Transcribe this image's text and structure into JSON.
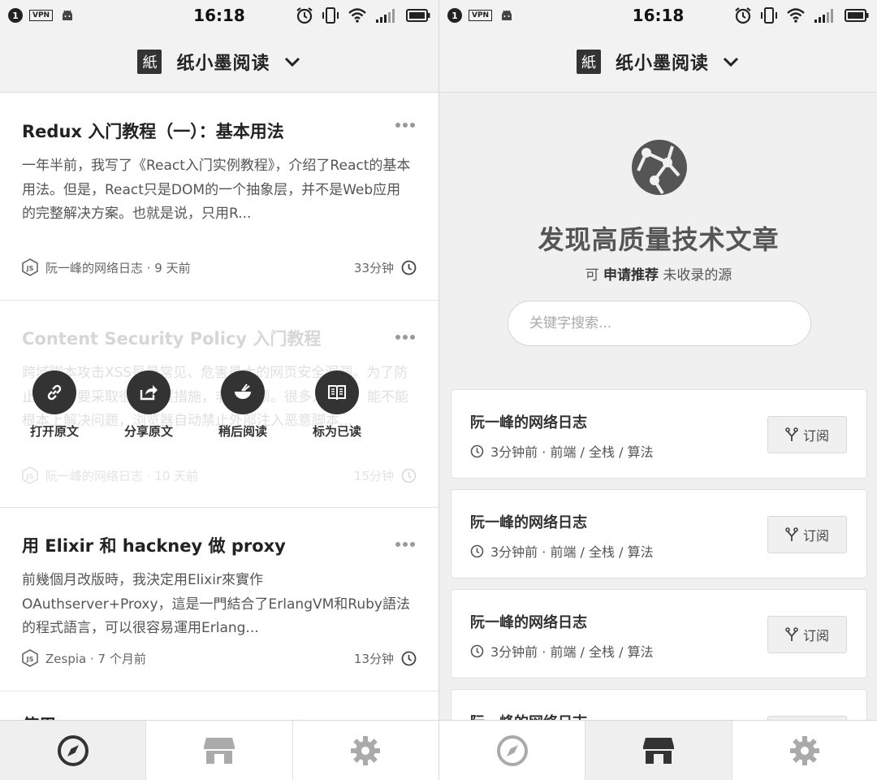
{
  "status_bar": {
    "badge": "1",
    "vpn": "VPN",
    "time": "16:18"
  },
  "header": {
    "logo_char": "紙",
    "title": "纸小墨阅读"
  },
  "feed": {
    "articles": [
      {
        "title": "Redux 入门教程（一）：基本用法",
        "excerpt": "一年半前，我写了《React入门实例教程》，介绍了React的基本用法。但是，React只是DOM的一个抽象层，并不是Web应用的完整解决方案。也就是说，只用R...",
        "source": "阮一峰的网络日志 · 9 天前",
        "read_time": "33分钟"
      },
      {
        "title": "Content Security Policy 入门教程",
        "excerpt": "跨域脚本攻击XSS是最常见、危害最大的网页安全漏洞。为了防止它们，要采取很多编程措施，非常麻烦。很多人提出，能不能根本上解决问题，浏览器自动禁止外部注入恶意脚本...",
        "source": "阮一峰的网络日志 · 10 天前",
        "read_time": "15分钟"
      },
      {
        "title": "用 Elixir 和 hackney 做 proxy",
        "excerpt": "前幾個月改版時，我決定用Elixir來實作OAuthserver+Proxy，這是一門結合了ErlangVM和Ruby語法的程式語言，可以很容易運用Erlang...",
        "source": "Zespia · 7 个月前",
        "read_time": "13分钟"
      }
    ],
    "actions": [
      {
        "label": "打开原文",
        "icon": "link-icon"
      },
      {
        "label": "分享原文",
        "icon": "share-icon"
      },
      {
        "label": "稍后阅读",
        "icon": "bowl-icon"
      },
      {
        "label": "标为已读",
        "icon": "book-icon"
      }
    ],
    "partial_next_title": "使用 ..."
  },
  "discover": {
    "title": "发现高质量技术文章",
    "subtitle_prefix": "可",
    "subtitle_bold": "申请推荐",
    "subtitle_suffix": "未收录的源",
    "search_placeholder": "关键字搜索...",
    "feeds": [
      {
        "name": "阮一峰的网络日志",
        "meta": "3分钟前 · 前端 / 全栈 / 算法",
        "button": "订阅"
      },
      {
        "name": "阮一峰的网络日志",
        "meta": "3分钟前 · 前端 / 全栈 / 算法",
        "button": "订阅"
      },
      {
        "name": "阮一峰的网络日志",
        "meta": "3分钟前 · 前端 / 全栈 / 算法",
        "button": "订阅"
      },
      {
        "name": "阮一峰的网络日志",
        "meta": "",
        "button": ""
      }
    ]
  },
  "tabs": [
    "compass-icon",
    "store-icon",
    "gear-icon"
  ],
  "colors": {
    "accent": "#333333",
    "background": "#f0f0f0",
    "text": "#555555"
  }
}
